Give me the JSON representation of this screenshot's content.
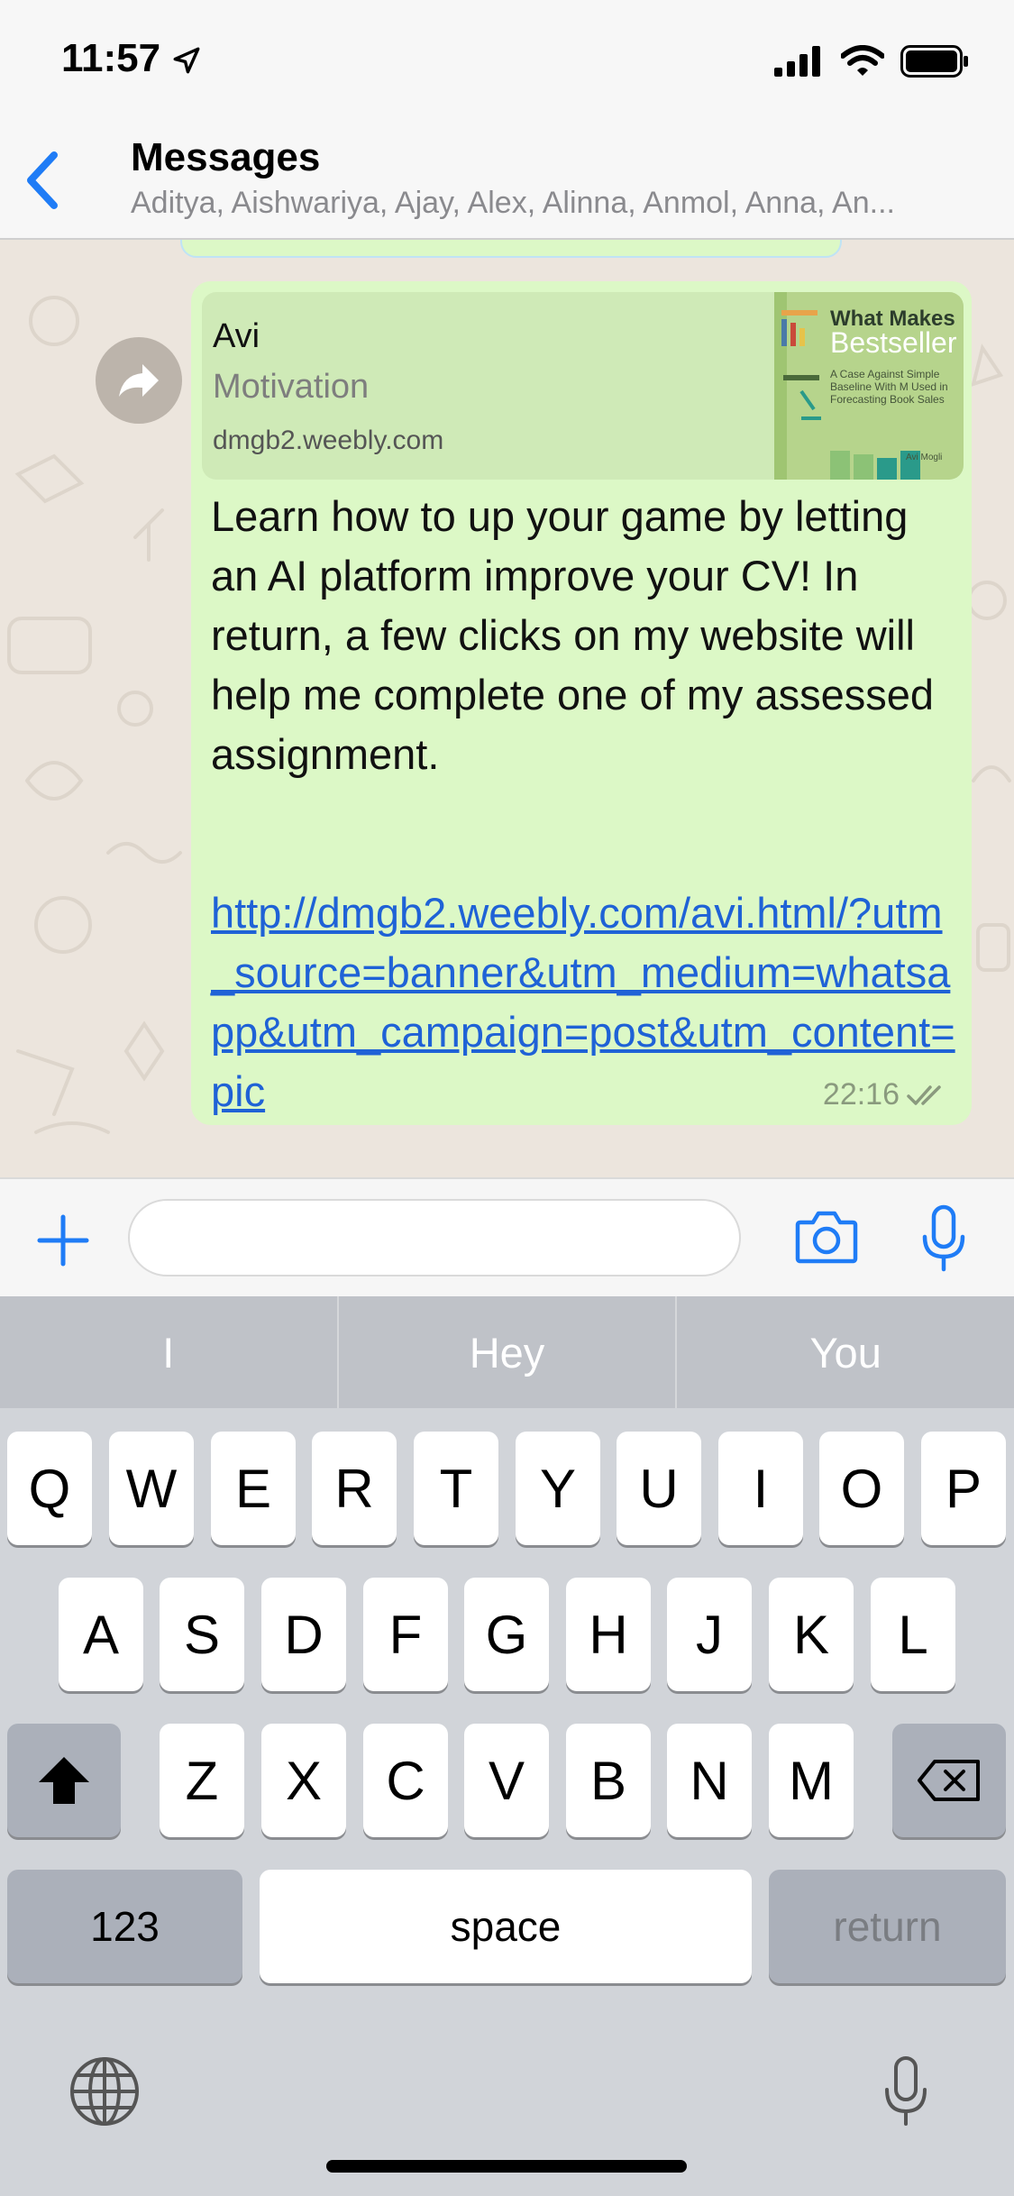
{
  "status": {
    "time": "11:57"
  },
  "nav": {
    "title": "Messages",
    "subtitle": "Aditya, Aishwariya, Ajay, Alex, Alinna, Anmol, Anna, An..."
  },
  "message": {
    "preview": {
      "author": "Avi",
      "title": "Motivation",
      "domain": "dmgb2.weebly.com",
      "thumb_line1": "What Makes",
      "thumb_line2": "Bestseller",
      "thumb_line3": "A Case Against Simple Baseline With M Used in Forecasting Book Sales",
      "thumb_line4": "Avi Mogli"
    },
    "text": "Learn how to up your game by letting an AI platform improve your CV! In return, a few clicks on my website will help me complete one of my assessed assignment.",
    "link": "http://dmgb2.weebly.com/avi.html/?utm_source=banner&utm_medium=whatsapp&utm_campaign=post&utm_content=pic",
    "time": "22:16"
  },
  "input": {
    "placeholder": ""
  },
  "keyboard": {
    "suggestions": [
      "I",
      "Hey",
      "You"
    ],
    "row1": [
      "Q",
      "W",
      "E",
      "R",
      "T",
      "Y",
      "U",
      "I",
      "O",
      "P"
    ],
    "row2": [
      "A",
      "S",
      "D",
      "F",
      "G",
      "H",
      "J",
      "K",
      "L"
    ],
    "row3": [
      "Z",
      "X",
      "C",
      "V",
      "B",
      "N",
      "M"
    ],
    "numbers_label": "123",
    "space_label": "space",
    "return_label": "return"
  },
  "colors": {
    "accent": "#1f7cf6",
    "bubble": "#dcf8c6",
    "chat_bg": "#ece5dd",
    "link": "#1f62d6"
  }
}
